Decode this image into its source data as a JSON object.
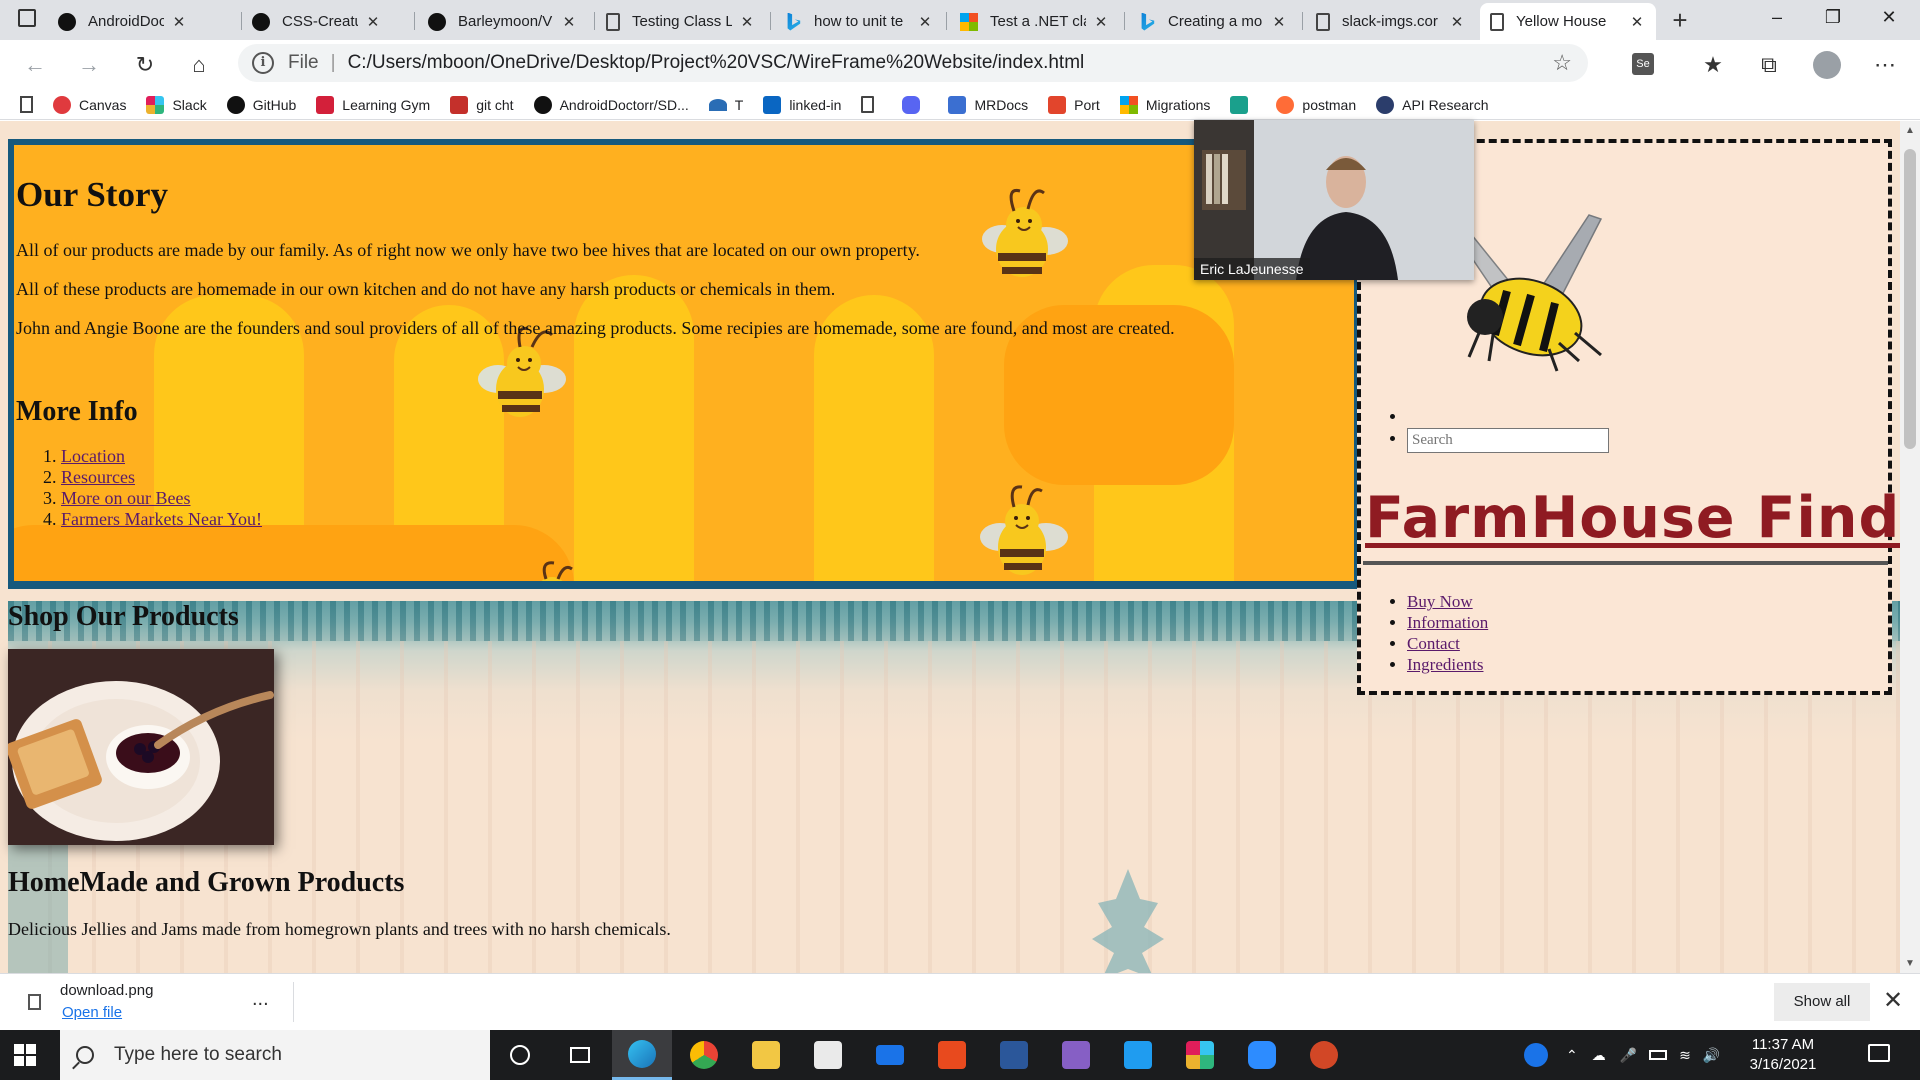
{
  "browser": {
    "tabs": [
      {
        "label": "AndroidDocto",
        "icon": "github-icon"
      },
      {
        "label": "CSS-Creature/",
        "icon": "github-icon"
      },
      {
        "label": "Barleymoon/V",
        "icon": "github-icon"
      },
      {
        "label": "Testing Class L",
        "icon": "document-icon"
      },
      {
        "label": "how to unit te",
        "icon": "bing-icon"
      },
      {
        "label": "Test a .NET cla",
        "icon": "microsoft-icon"
      },
      {
        "label": "Creating a mo",
        "icon": "bing-icon"
      },
      {
        "label": "slack-imgs.cor",
        "icon": "document-icon"
      },
      {
        "label": "Yellow House",
        "icon": "document-icon",
        "active": true
      }
    ],
    "address": {
      "scheme": "File",
      "url": "C:/Users/mboon/OneDrive/Desktop/Project%20VSC/WireFrame%20Website/index.html"
    },
    "bookmarks": [
      {
        "label": "Canvas",
        "color": "#e03a3e"
      },
      {
        "label": "Slack",
        "color": "#4a154b"
      },
      {
        "label": "GitHub",
        "color": "#111111"
      },
      {
        "label": "Learning Gym",
        "color": "#d3203a"
      },
      {
        "label": "git cht",
        "color": "#c4302b"
      },
      {
        "label": "AndroidDoctorr/SD...",
        "color": "#111111"
      },
      {
        "label": "T",
        "color": "#2a6db5"
      },
      {
        "label": "linked-in",
        "color": "#0a66c2"
      },
      {
        "label": "",
        "color": "#555555"
      },
      {
        "label": "",
        "color": "#5865f2"
      },
      {
        "label": "MRDocs",
        "color": "#3b6fd1"
      },
      {
        "label": "Port",
        "color": "#e2452c"
      },
      {
        "label": "Migrations",
        "color": "#f25022"
      },
      {
        "label": "",
        "color": "#1aa08c"
      },
      {
        "label": "postman",
        "color": "#ff6c37"
      },
      {
        "label": "API Research",
        "color": "#2b3d6b"
      }
    ]
  },
  "page": {
    "story": {
      "title": "Our Story",
      "paragraphs": [
        "All of our products are made by our family. As of right now we only have two bee hives that are located on our own property.",
        "All of these products are homemade in our own kitchen and do not have any harsh products or chemicals in them.",
        "John and Angie Boone are the founders and soul providers of all of these amazing products. Some recipies are homemade, some are found, and most are created."
      ],
      "more_info_title": "More Info",
      "links": [
        "Location",
        "Resources",
        "More on our Bees",
        "Farmers Markets Near You!"
      ]
    },
    "shop": {
      "title": "Shop Our Products",
      "product_title": "HomeMade and Grown Products",
      "product_desc": "Delicious Jellies and Jams made from homegrown plants and trees with no harsh chemicals."
    },
    "sidebar": {
      "search_placeholder": "Search",
      "brand": "FarmHouse Finds",
      "nav": [
        "Buy Now",
        "Information",
        "Contact",
        "Ingredients"
      ]
    }
  },
  "video_overlay": {
    "name": "Eric LaJeunesse"
  },
  "download_bar": {
    "file": "download.png",
    "open": "Open file",
    "more": "...",
    "show_all": "Show all"
  },
  "taskbar": {
    "search_placeholder": "Type here to search",
    "time": "11:37 AM",
    "date": "3/16/2021"
  },
  "colors": {
    "story_bg": "#ffb01f",
    "story_border": "#16597d",
    "brand": "#8f1b22",
    "link": "#5a1a6b"
  }
}
